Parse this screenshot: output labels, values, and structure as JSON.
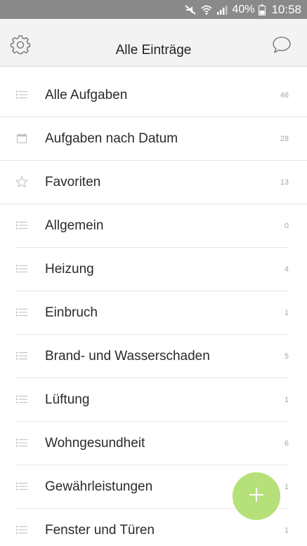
{
  "status_bar": {
    "battery": "40%",
    "time": "10:58",
    "icons": [
      "mute-icon",
      "wifi-icon",
      "signal-icon",
      "battery-icon"
    ]
  },
  "app_bar": {
    "title": "Alle Einträge",
    "left_icon": "gear-icon",
    "right_icon": "chat-bubble-icon"
  },
  "lists": [
    {
      "label": "Alle Aufgaben",
      "count": "46",
      "icon": "list-icon"
    },
    {
      "label": "Aufgaben nach Datum",
      "count": "28",
      "icon": "calendar-icon"
    },
    {
      "label": "Favoriten",
      "count": "13",
      "icon": "star-icon"
    },
    {
      "label": "Allgemein",
      "count": "0",
      "icon": "list-icon"
    },
    {
      "label": "Heizung",
      "count": "4",
      "icon": "list-icon"
    },
    {
      "label": "Einbruch",
      "count": "1",
      "icon": "list-icon"
    },
    {
      "label": "Brand- und Wasserschaden",
      "count": "5",
      "icon": "list-icon"
    },
    {
      "label": "Lüftung",
      "count": "1",
      "icon": "list-icon"
    },
    {
      "label": "Wohngesundheit",
      "count": "6",
      "icon": "list-icon"
    },
    {
      "label": "Gewährleistungen",
      "count": "1",
      "icon": "list-icon"
    },
    {
      "label": "Fenster und Türen",
      "count": "1",
      "icon": "list-icon"
    }
  ],
  "fab": {
    "icon": "plus-icon"
  },
  "colors": {
    "status_bar": "#8a8a8a",
    "app_bar": "#f3f3f3",
    "fab": "#b6e07a",
    "count_text": "#a8a8a8"
  }
}
